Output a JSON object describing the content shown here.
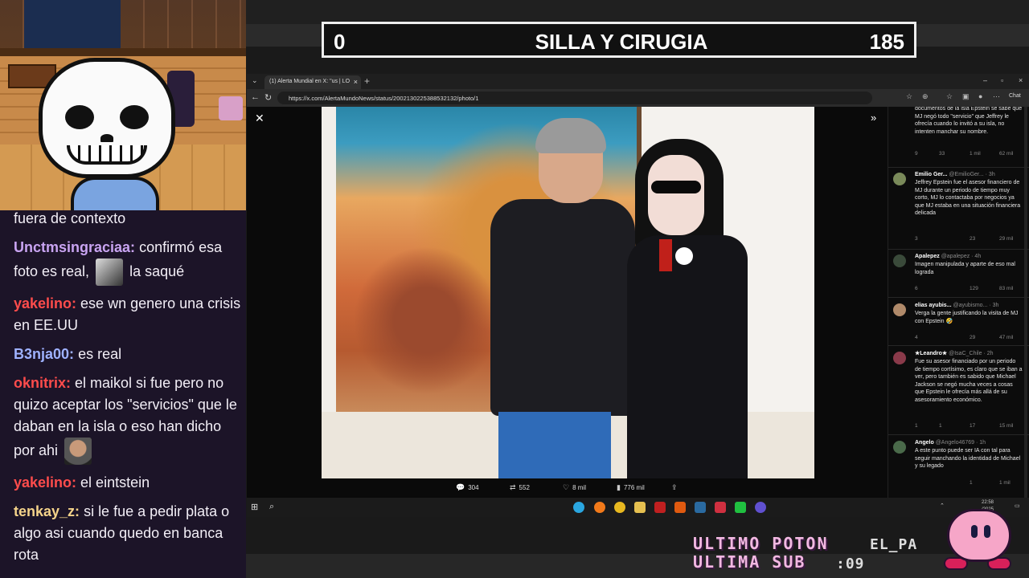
{
  "banner": {
    "left_count": "0",
    "title": "SILLA Y CIRUGIA",
    "right_count": "185"
  },
  "chat": [
    {
      "user": "",
      "text": "fuera de contexto",
      "color": "#f2eef6"
    },
    {
      "user": "Unctmsingraciaa:",
      "text_before": "confirmó esa foto es real,",
      "emote": "emote",
      "text": "la saqué",
      "color": "#c9a4f2"
    },
    {
      "user": "yakelino:",
      "text": "ese wn genero una crisis en EE.UU",
      "color": "#ff4c4c"
    },
    {
      "user": "B3nja00:",
      "text": "es real",
      "color": "#9fb2ff"
    },
    {
      "user": "oknitrix:",
      "text": "el maikol si fue pero no quizo aceptar los \"servicios\" que le daban en la isla o eso han dicho por ahi",
      "emote": "WE",
      "color": "#ff4c4c"
    },
    {
      "user": "yakelino:",
      "text": "el eintstein",
      "color": "#ff4c4c"
    },
    {
      "user": "tenkay_z:",
      "text": "si le fue a pedir plata o algo asi cuando quedo en banca rota",
      "color": "#f4d38a"
    }
  ],
  "browser": {
    "tab_title": "(1) Alerta Mundial en X: \"us | LO",
    "url": "https://x.com/AlertaMundoNews/status/2002130225388532132/photo/1",
    "chat_label": "Chat"
  },
  "photo_actions": {
    "replies": "304",
    "reposts": "552",
    "likes": "8 mil",
    "views": "776 mil"
  },
  "replies": [
    {
      "name": "",
      "handle": "",
      "text": "documentos de la isla Epstein se sabe que MJ negó todo \"servicio\" que Jeffrey le ofrecía cuando lo invitó a su isla, no intenten manchar su nombre.",
      "stats": [
        "9",
        "33",
        "1 mil",
        "62 mil"
      ]
    },
    {
      "name": "Emilio Ger...",
      "handle": "@EmilioGer... · 3h",
      "text": "Jeffrey Epstein fue el asesor financiero de MJ durante un periodo de tiempo muy corto, MJ lo contactaba por negocios ya que MJ estaba en una situación financiera delicada",
      "stats": [
        "3",
        "",
        "23",
        "29 mil"
      ]
    },
    {
      "name": "Apalepez",
      "handle": "@apalepez · 4h",
      "text": "Imagen manipulada y aparte de eso mal lograda",
      "stats": [
        "6",
        "",
        "129",
        "83 mil"
      ]
    },
    {
      "name": "elias ayubis...",
      "handle": "@ayubismo... · 3h",
      "text": "Verga la gente justificando la visita de MJ con Epstein 🤣",
      "stats": [
        "4",
        "",
        "29",
        "47 mil"
      ]
    },
    {
      "name": "★Leandro★",
      "handle": "@IsaC_Chile · 2h",
      "text": "Fue su asesor financiado por un periodo de tiempo cortísimo, es claro que se iban a ver, pero también es sabido que Michael Jackson se negó mucha veces a cosas que Epstein le ofrecía más allá de su asesoramiento económico.",
      "stats": [
        "1",
        "1",
        "17",
        "15 mil"
      ]
    },
    {
      "name": "Angelo",
      "handle": "@Angelo46769 · 1h",
      "text": "A este punto puede ser IA con tal para seguir manchando la identidad de Michael y su legado",
      "stats": [
        "",
        "",
        "1",
        "1 mil"
      ]
    }
  ],
  "taskbar": {
    "time": "22:58",
    "date": "/2025"
  },
  "overlay": {
    "line1": "ULTIMO POTON",
    "line2": "ULTIMA SUB",
    "suffix": "EL_PA",
    "counter": ":09"
  },
  "icons": [
    "windows-icon",
    "search-icon",
    "edge-icon",
    "firefox-icon",
    "chrome-icon",
    "folder-icon",
    "app-icon",
    "steam-icon",
    "valorant-icon",
    "game-icon",
    "obs-icon"
  ]
}
